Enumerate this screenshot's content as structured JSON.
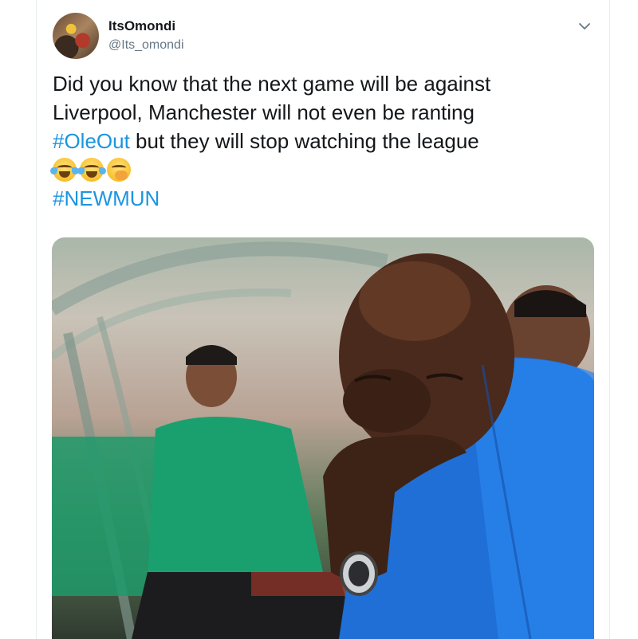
{
  "tweet": {
    "display_name": "ItsOmondi",
    "handle": "@Its_omondi",
    "text_lines": [
      "Did you know that the next game will be against",
      "Liverpool, Manchester will not even be ranting"
    ],
    "line3_hashtag": "#OleOut",
    "line3_rest": " but they will stop watching the league",
    "emojis": [
      "face-with-tears-of-joy",
      "face-with-tears-of-joy",
      "face-with-hand-over-mouth"
    ],
    "hashtag2": "#NEWMUN"
  },
  "colors": {
    "hashtag": "#1b95e0",
    "text": "#14171a",
    "secondary": "#657786",
    "border": "#e6ecf0"
  },
  "media": {
    "icon": "photo"
  }
}
